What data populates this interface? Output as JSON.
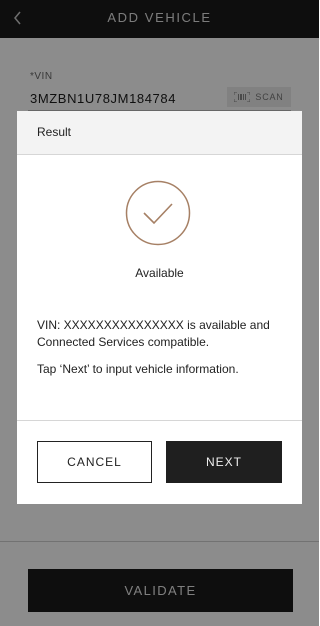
{
  "header": {
    "title": "ADD VEHICLE",
    "back_icon": "chevron-left-icon"
  },
  "form": {
    "vin_label": "*VIN",
    "vin_value": "3MZBN1U78JM184784",
    "scan_label": "SCAN",
    "scan_icon": "barcode-scan-icon"
  },
  "validate_label": "VALIDATE",
  "dialog": {
    "title": "Result",
    "status_icon": "check-circle-icon",
    "status": "Available",
    "message": "VIN: XXXXXXXXXXXXXXX is available and Connected Services compatible.",
    "hint": "Tap ‘Next’ to input vehicle information.",
    "cancel_label": "CANCEL",
    "next_label": "NEXT"
  },
  "colors": {
    "accent_check": "#a68065",
    "header_bg": "#1b1b1b",
    "button_dark": "#1f1f1f"
  }
}
